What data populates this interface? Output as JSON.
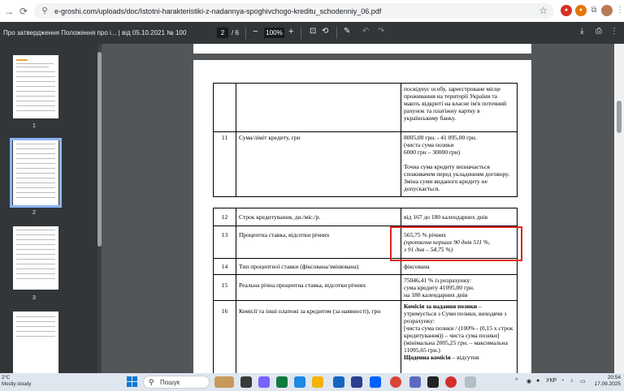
{
  "browser": {
    "url": "e-groshi.com/uploads/doc/Istotni-harakteristiki-z-nadannya-spoghivchogo-kreditu_schodenniy_06.pdf"
  },
  "pdf_toolbar": {
    "title": "Про затвердження Положення про і... | від 05.10.2021 № 100",
    "current_page": "2",
    "total_pages": "/ 6",
    "zoom": "100%"
  },
  "sidebar": {
    "pages": [
      "1",
      "2",
      "3"
    ]
  },
  "doc": {
    "row_cont": {
      "value": "посвідчує особу, зареєстроване місце проживання на території України та мають відкриті на власне ім'я поточний рахунок та платіжну картку в українському банку."
    },
    "row11": {
      "num": "11",
      "name": "Сума/ліміт кредиту, грн",
      "v1": "8005,00 грн. - 41 095,00 грн.",
      "v2": "(чиста сума позики",
      "v3": "6000 грн – 30000 грн)",
      "v4": "Точна сума кредиту визначається споживачем перед укладенням договору. Зміна суми виданого кредиту не допускається."
    },
    "row12": {
      "num": "12",
      "name": "Строк кредитування, дн./міс./р.",
      "value": "від 167 до 180 календарних днів"
    },
    "row13": {
      "num": "13",
      "name": "Процентна ставка, відсотки річних",
      "v1": "565,75 % річних",
      "v2": "(протягом перших 90 днів 511 %,",
      "v3": "з 91 дня – 54,75 %)"
    },
    "row14": {
      "num": "14",
      "name": "Тип процентної ставки (фіксована/змінювана)",
      "value": "фіксована"
    },
    "row15": {
      "num": "15",
      "name": "Реальна річна процентна ставка, відсотки річних",
      "v1": "75046,41 % із розрахунку:",
      "v2": "сума кредиту 41095,00 грн.",
      "v3": "на 180 календарних днів"
    },
    "row16": {
      "num": "16",
      "name": "Комісії та інші платежі за кредитом (за наявності), грн",
      "v1_bold": "Комісія за надання позики",
      "v1_rest": " – утримується з Суми позики, виходячи з розрахунку:",
      "v2": "[чиста сума позики / (100% - (0,15 x строк кредитування)) – чиста сума позики]",
      "v3": "(мінімальна 2005,25 грн. – максимальна 11095,65 грн.)",
      "v4_bold": "Щоденна комісія",
      "v4_rest": " – відсутня"
    }
  },
  "taskbar": {
    "weather_temp": "2°C",
    "weather_desc": "Mostly cloudy",
    "search_placeholder": "Пошук",
    "lang": "УКР",
    "time": "20:54",
    "date": "17.09.2025"
  }
}
